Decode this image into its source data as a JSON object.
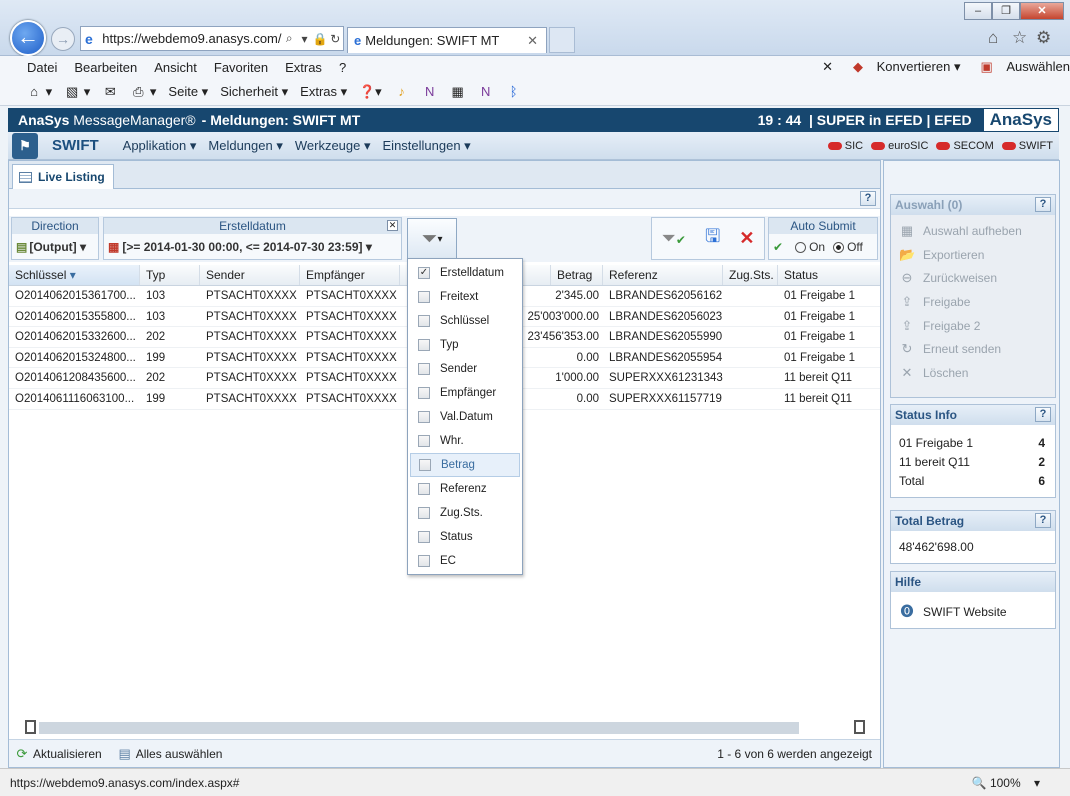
{
  "browser": {
    "url": "https://webdemo9.anasys.com/",
    "tab_title": "Meldungen: SWIFT MT",
    "menu": [
      "Datei",
      "Bearbeiten",
      "Ansicht",
      "Favoriten",
      "Extras",
      "?"
    ],
    "menu_right": {
      "close": "✕",
      "convert": "Konvertieren",
      "select": "Auswählen"
    },
    "cmd": {
      "page": "Seite",
      "security": "Sicherheit",
      "extras": "Extras"
    },
    "status_url": "https://webdemo9.anasys.com/index.aspx#",
    "zoom": "100%"
  },
  "app": {
    "brand_pre": "AnaSys",
    "brand_post": "MessageManager®",
    "title": "- Meldungen: SWIFT MT",
    "clock": "19 : 44",
    "user": "| SUPER in EFED | EFED",
    "logo": "AnaSys",
    "module": "SWIFT",
    "nav": [
      "Applikation ▾",
      "Meldungen ▾",
      "Werkzeuge ▾",
      "Einstellungen ▾"
    ],
    "status_lights": [
      "SIC",
      "euroSIC",
      "SECOM",
      "SWIFT"
    ],
    "status_color": "#d62a2a",
    "header_color": "#17476f"
  },
  "listing": {
    "tab_label": "Live Listing",
    "filters": {
      "direction_label": "Direction",
      "direction_value": "[Output]",
      "date_label": "Erstelldatum",
      "date_value": "[>= 2014-01-30 00:00, <= 2014-07-30 23:59]",
      "auto_submit_label": "Auto Submit",
      "on_label": "On",
      "off_label": "Off",
      "auto_submit_selected": "Off"
    },
    "columns": [
      "Schlüssel",
      "Typ",
      "Sender",
      "Empfänger",
      "",
      "",
      "Betrag",
      "Referenz",
      "Zug.Sts.",
      "Status"
    ],
    "rows": [
      [
        "O2014062015361700...",
        "103",
        "PTSACHT0XXXX",
        "PTSACHT0XXXX",
        "2'345.00",
        "LBRANDES62056162",
        "",
        "01 Freigabe 1"
      ],
      [
        "O2014062015355800...",
        "103",
        "PTSACHT0XXXX",
        "PTSACHT0XXXX",
        "25'003'000.00",
        "LBRANDES62056023",
        "",
        "01 Freigabe 1"
      ],
      [
        "O2014062015332600...",
        "202",
        "PTSACHT0XXXX",
        "PTSACHT0XXXX",
        "23'456'353.00",
        "LBRANDES62055990",
        "",
        "01 Freigabe 1"
      ],
      [
        "O2014062015324800...",
        "199",
        "PTSACHT0XXXX",
        "PTSACHT0XXXX",
        "0.00",
        "LBRANDES62055954",
        "",
        "01 Freigabe 1"
      ],
      [
        "O2014061208435600...",
        "202",
        "PTSACHT0XXXX",
        "PTSACHT0XXXX",
        "1'000.00",
        "SUPERXXX61231343",
        "",
        "11 bereit Q11"
      ],
      [
        "O2014061116063100...",
        "199",
        "PTSACHT0XXXX",
        "PTSACHT0XXXX",
        "0.00",
        "SUPERXXX61157719",
        "",
        "11 bereit Q11"
      ]
    ],
    "refresh_label": "Aktualisieren",
    "select_all_label": "Alles auswählen",
    "paging": "1 - 6 von 6 werden angezeigt"
  },
  "column_menu": {
    "items": [
      {
        "label": "Erstelldatum",
        "checked": true
      },
      {
        "label": "Freitext",
        "checked": false
      },
      {
        "label": "Schlüssel",
        "checked": false
      },
      {
        "label": "Typ",
        "checked": false
      },
      {
        "label": "Sender",
        "checked": false
      },
      {
        "label": "Empfänger",
        "checked": false
      },
      {
        "label": "Val.Datum",
        "checked": false
      },
      {
        "label": "Whr.",
        "checked": false
      },
      {
        "label": "Betrag",
        "checked": false
      },
      {
        "label": "Referenz",
        "checked": false
      },
      {
        "label": "Zug.Sts.",
        "checked": false
      },
      {
        "label": "Status",
        "checked": false
      },
      {
        "label": "EC",
        "checked": false
      }
    ],
    "highlighted": "Betrag"
  },
  "sidebar": {
    "selection": {
      "title": "Auswahl (0)",
      "actions": [
        "Auswahl aufheben",
        "Exportieren",
        "Zurückweisen",
        "Freigabe",
        "Freigabe 2",
        "Erneut senden",
        "Löschen"
      ]
    },
    "status_info": {
      "title": "Status Info",
      "rows": [
        {
          "label": "01 Freigabe 1",
          "value": "4"
        },
        {
          "label": "11 bereit Q11",
          "value": "2"
        },
        {
          "label": "Total",
          "value": "6"
        }
      ]
    },
    "total_amount": {
      "title": "Total Betrag",
      "value": "48'462'698.00"
    },
    "help": {
      "title": "Hilfe",
      "link": "SWIFT Website"
    }
  }
}
